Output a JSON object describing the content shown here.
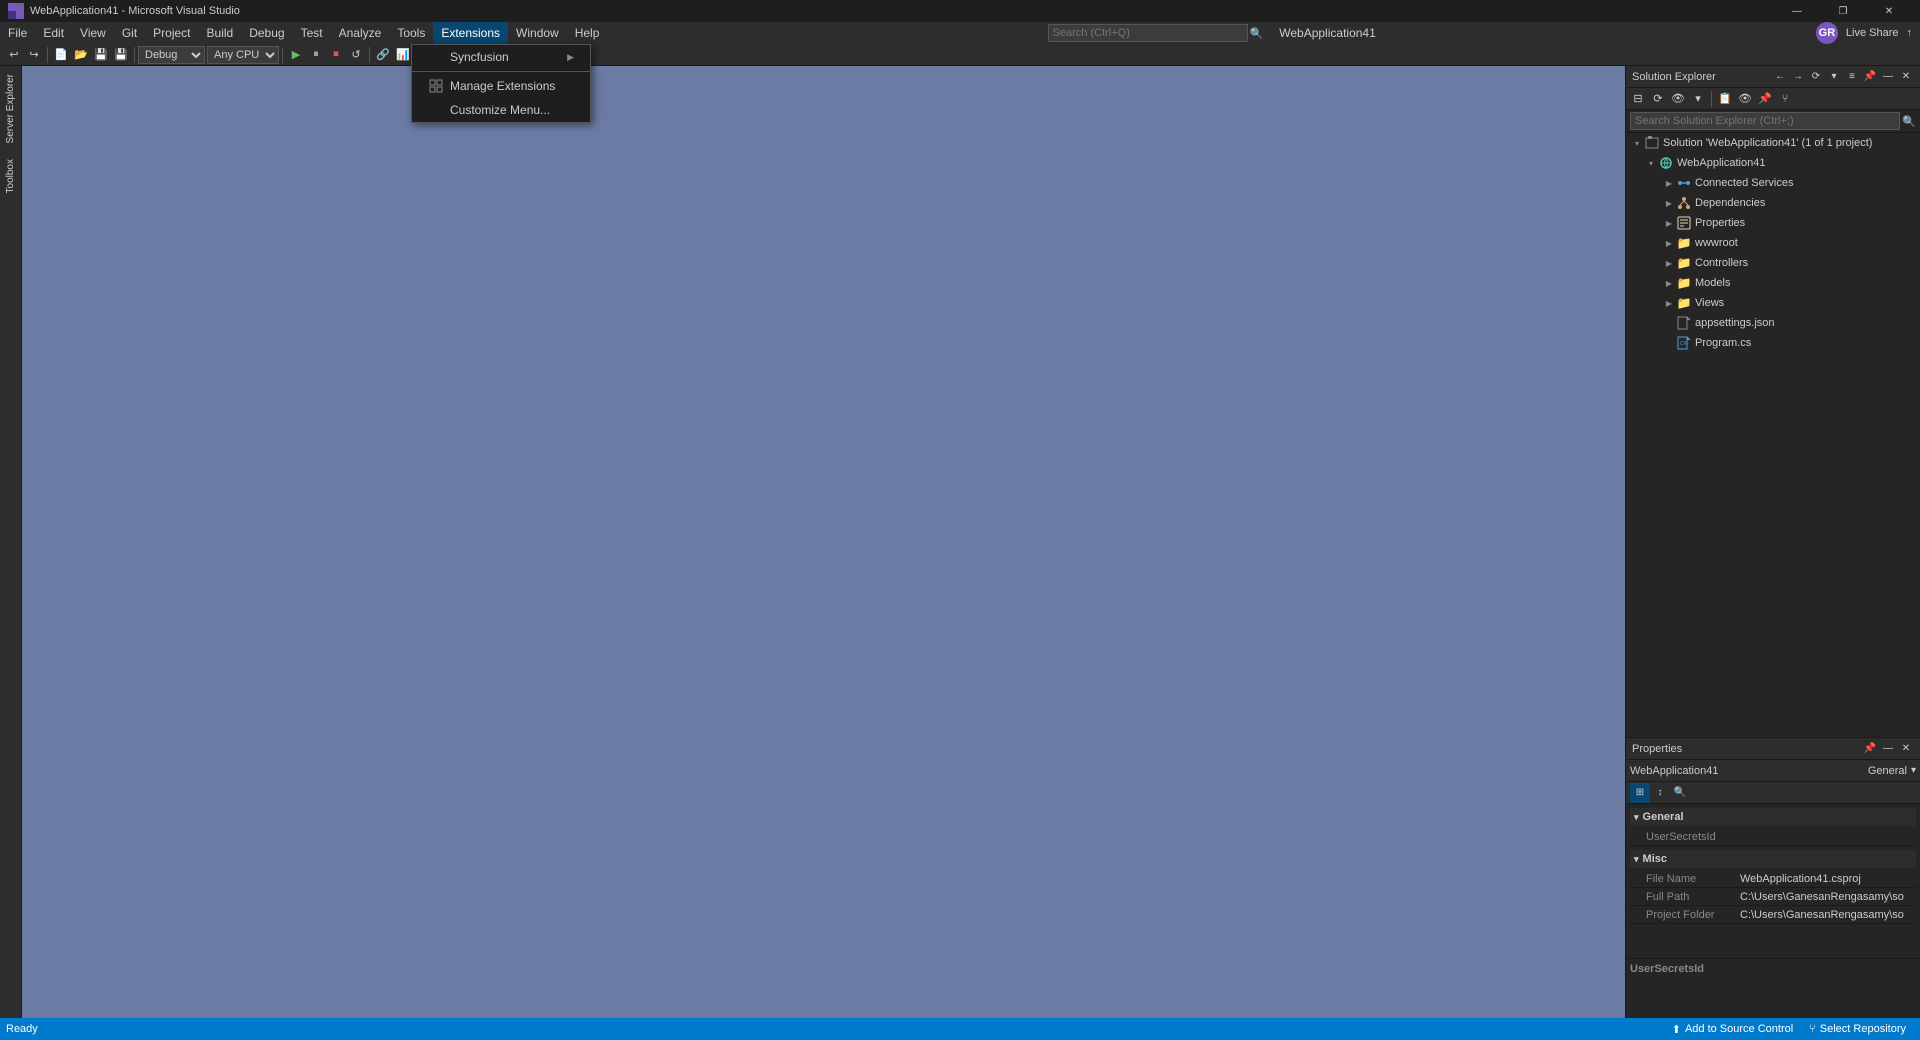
{
  "titleBar": {
    "icon": "⬛",
    "title": "WebApplication41 - Microsoft Visual Studio",
    "controls": [
      "—",
      "❐",
      "✕"
    ]
  },
  "menuBar": {
    "items": [
      "File",
      "Edit",
      "View",
      "Git",
      "Project",
      "Build",
      "Debug",
      "Test",
      "Analyze",
      "Tools",
      "Extensions",
      "Window",
      "Help"
    ],
    "activeItem": "Extensions",
    "search": {
      "placeholder": "Search (Ctrl+Q)"
    },
    "projectTitle": "WebApplication41",
    "rightIcons": [
      "GR",
      "Live Share",
      "↑"
    ]
  },
  "extensionsMenu": {
    "items": [
      {
        "label": "Syncfusion",
        "hasArrow": true,
        "icon": ""
      },
      {
        "label": "Manage Extensions",
        "icon": "📦",
        "hasArrow": false
      },
      {
        "label": "Customize Menu...",
        "icon": "",
        "hasArrow": false
      }
    ]
  },
  "toolbar": {
    "debugMode": "Debug",
    "platform": "Any C",
    "buttons": [
      "↩",
      "↪",
      "⬡",
      "⬡",
      "◻",
      "▶",
      "⏸",
      "⏹",
      "↺",
      "⬡",
      "⬡",
      "⬡"
    ]
  },
  "leftToolbar": {
    "items": [
      "Server Explorer",
      "Toolbox"
    ]
  },
  "solutionExplorer": {
    "title": "Solution Explorer",
    "searchPlaceholder": "Search Solution Explorer (Ctrl+;)",
    "tree": {
      "root": {
        "label": "Solution 'WebApplication41' (1 of 1 project)",
        "icon": "🗂",
        "expanded": true,
        "children": [
          {
            "label": "WebApplication41",
            "icon": "🌐",
            "expanded": true,
            "children": [
              {
                "label": "Connected Services",
                "icon": "🔗",
                "expanded": false
              },
              {
                "label": "Dependencies",
                "icon": "🔧",
                "expanded": false
              },
              {
                "label": "Properties",
                "icon": "🔑",
                "expanded": false
              },
              {
                "label": "wwwroot",
                "icon": "📁",
                "expanded": false
              },
              {
                "label": "Controllers",
                "icon": "📁",
                "expanded": false
              },
              {
                "label": "Models",
                "icon": "📁",
                "expanded": false
              },
              {
                "label": "Views",
                "icon": "📁",
                "expanded": false
              },
              {
                "label": "appsettings.json",
                "icon": "📄",
                "expanded": false
              },
              {
                "label": "Program.cs",
                "icon": "📄",
                "expanded": false
              }
            ]
          }
        ]
      }
    }
  },
  "properties": {
    "title": "Properties",
    "objectName": "WebApplication41",
    "category": "General",
    "sections": {
      "general": {
        "label": "General",
        "rows": [
          {
            "key": "UserSecretsId",
            "value": ""
          }
        ]
      },
      "misc": {
        "label": "Misc",
        "rows": [
          {
            "key": "File Name",
            "value": "WebApplication41.csproj"
          },
          {
            "key": "Full Path",
            "value": "C:\\Users\\GanesanRengasamy\\so"
          },
          {
            "key": "Project Folder",
            "value": "C:\\Users\\GanesanRengasamy\\so"
          }
        ]
      }
    },
    "footer": "UserSecretsId",
    "toolbarButtons": [
      "⊞",
      "↕",
      "🔍"
    ]
  },
  "statusBar": {
    "readyText": "Ready",
    "sourceControl": "Add to Source Control",
    "repository": "Select Repository"
  }
}
